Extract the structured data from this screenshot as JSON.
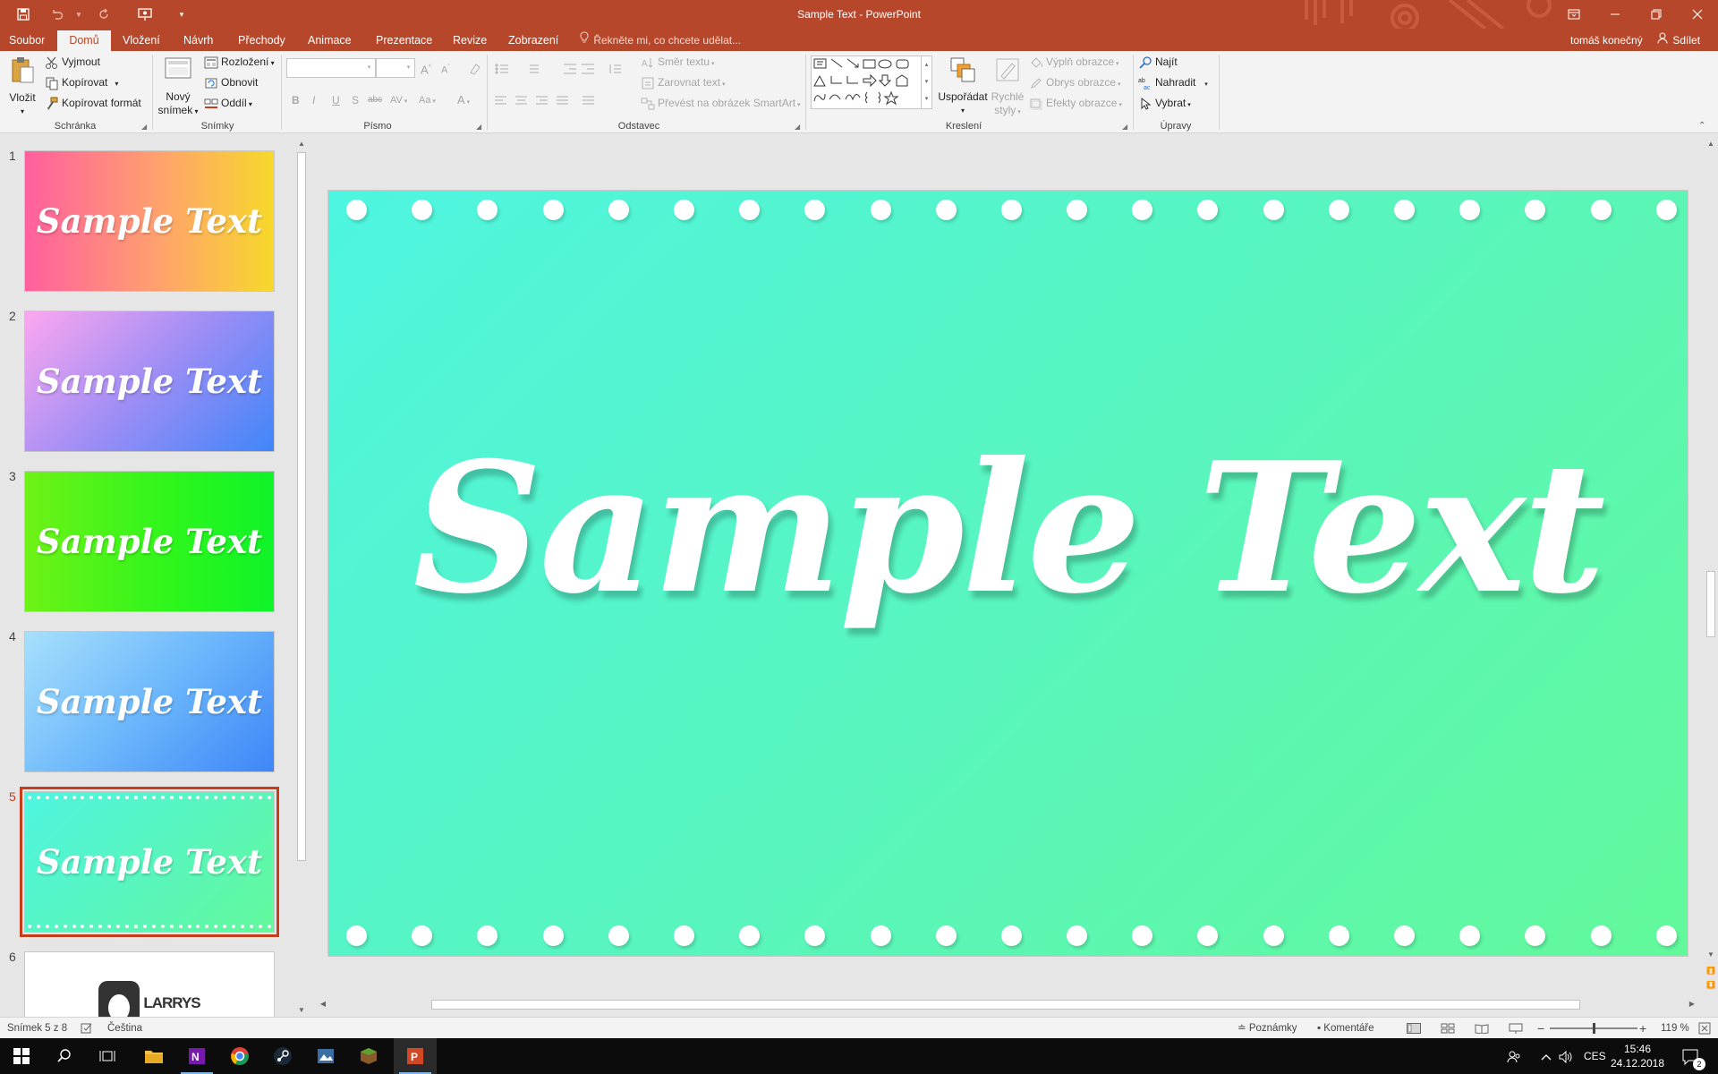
{
  "app": {
    "window_title": "Sample Text - PowerPoint",
    "user_name": "tomáš konečný",
    "share_label": "Sdílet"
  },
  "tabs": [
    {
      "label": "Soubor"
    },
    {
      "label": "Domů"
    },
    {
      "label": "Vložení"
    },
    {
      "label": "Návrh"
    },
    {
      "label": "Přechody"
    },
    {
      "label": "Animace"
    },
    {
      "label": "Prezentace"
    },
    {
      "label": "Revize"
    },
    {
      "label": "Zobrazení"
    }
  ],
  "active_tab": "Domů",
  "tell_me": "Řekněte mi, co chcete udělat...",
  "ribbon": {
    "clipboard": {
      "paste": "Vložit",
      "cut": "Vyjmout",
      "copy": "Kopírovat",
      "format_painter": "Kopírovat formát",
      "group_label": "Schránka"
    },
    "slides": {
      "new_slide_line1": "Nový",
      "new_slide_line2": "snímek",
      "layout": "Rozložení",
      "reset": "Obnovit",
      "section": "Oddíl",
      "group_label": "Snímky"
    },
    "font": {
      "group_label": "Písmo",
      "bold": "B",
      "italic": "I",
      "underline": "U",
      "shadow": "S",
      "strike": "abc",
      "spacing": "AV",
      "case": "Aa",
      "grow": "A",
      "shrink": "A",
      "color": "A"
    },
    "paragraph": {
      "text_direction": "Směr textu",
      "align_text": "Zarovnat text",
      "smartart": "Převést na obrázek SmartArt",
      "group_label": "Odstavec"
    },
    "drawing": {
      "arrange": "Uspořádat",
      "quick_styles_line1": "Rychlé",
      "quick_styles_line2": "styly",
      "shape_fill": "Výplň obrazce",
      "shape_outline": "Obrys obrazce",
      "shape_effects": "Efekty obrazce",
      "group_label": "Kreslení"
    },
    "editing": {
      "find": "Najít",
      "replace": "Nahradit",
      "select": "Vybrat",
      "group_label": "Úpravy"
    }
  },
  "thumbnails": [
    {
      "num": "1",
      "text": "Sample Text",
      "bg": "linear-gradient(90deg,#ff5f9e,#ffa36c 55%,#f7d92a)"
    },
    {
      "num": "2",
      "text": "Sample Text",
      "bg": "linear-gradient(135deg,#fca7ef,#9e8df5 50%,#3f86f8)"
    },
    {
      "num": "3",
      "text": "Sample Text",
      "bg": "linear-gradient(90deg,#6ef216,#2cf61c 60%,#0ff42a)"
    },
    {
      "num": "4",
      "text": "Sample Text",
      "bg": "linear-gradient(135deg,#a7e0fb,#6cb7fb 50%,#3e86f8)"
    },
    {
      "num": "5",
      "text": "Sample Text",
      "bg": "linear-gradient(135deg,#4ef5e0,#58f5bf 50%,#62f99b)"
    },
    {
      "num": "6",
      "text": "LARRYS",
      "bg": "#ffffff"
    }
  ],
  "active_slide": 5,
  "slide": {
    "title": "Sample Text"
  },
  "status": {
    "slide_count": "Snímek 5 z 8",
    "language": "Čeština",
    "notes": "Poznámky",
    "comments": "Komentáře",
    "zoom": "119 %"
  },
  "taskbar": {
    "language": "CES",
    "time": "15:46",
    "date": "24.12.2018",
    "notifications": "2"
  }
}
